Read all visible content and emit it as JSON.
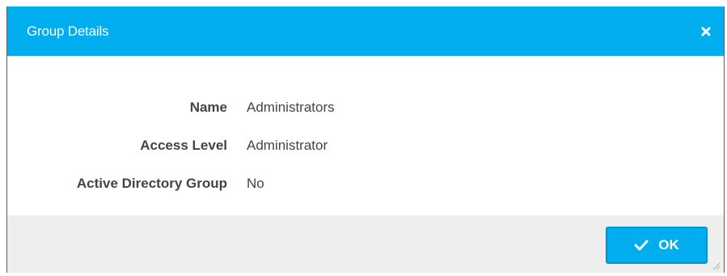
{
  "dialog": {
    "title": "Group Details",
    "close_icon": "close-icon",
    "fields": [
      {
        "label": "Name",
        "value": "Administrators"
      },
      {
        "label": "Access Level",
        "value": "Administrator"
      },
      {
        "label": "Active Directory Group",
        "value": "No"
      }
    ],
    "ok_label": "OK",
    "ok_icon": "check-icon"
  },
  "colors": {
    "accent": "#00aeef",
    "footer_bg": "#eeeeee",
    "text": "#444444"
  }
}
